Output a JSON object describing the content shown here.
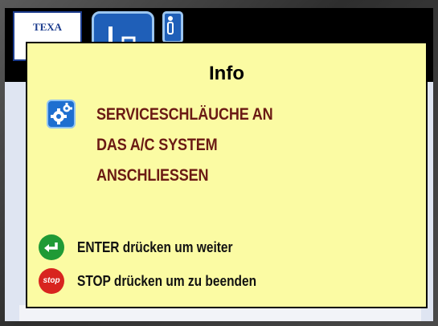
{
  "brand": {
    "logo_text": "TEXA"
  },
  "dialog": {
    "title": "Info",
    "icon": "gear-icon",
    "message_lines": [
      "SERVICESCHLÄUCHE AN",
      "DAS A/C SYSTEM",
      "ANSCHLIESSEN"
    ],
    "enter_hint": "ENTER drücken um weiter",
    "stop_hint": "STOP drücken um zu beenden",
    "stop_icon_text": "stop"
  },
  "colors": {
    "dialog_bg": "#fbfba3",
    "message_text": "#6b1a14",
    "enter_green": "#1f9a35",
    "stop_red": "#d8241f",
    "toolbar_blue": "#1f5fb8"
  }
}
